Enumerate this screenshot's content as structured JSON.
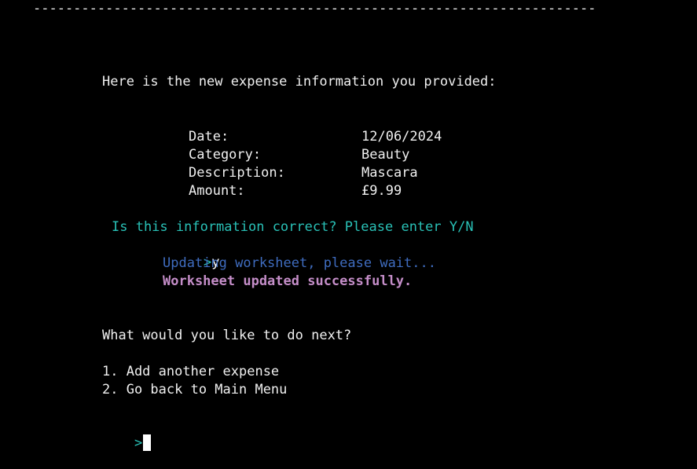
{
  "divider": "----------------------------------------------------------------------",
  "intro": "Here is the new expense information you provided:",
  "expense": {
    "rows": [
      {
        "label": "Date:",
        "value": "12/06/2024"
      },
      {
        "label": "Category:",
        "value": "Beauty"
      },
      {
        "label": "Description:",
        "value": "Mascara"
      },
      {
        "label": "Amount:",
        "value": "£9.99"
      }
    ]
  },
  "confirm_prompt": "Is this information correct? Please enter Y/N",
  "prompt_symbol": ">",
  "user_input": "y",
  "status": {
    "updating": "Updating worksheet, please wait...",
    "success": "Worksheet updated successfully."
  },
  "next_question": "What would you like to do next?",
  "options": [
    "1. Add another expense",
    "2. Go back to Main Menu"
  ],
  "colors": {
    "background": "#000000",
    "text": "#f0f0f0",
    "prompt_cyan": "#29c0b6",
    "status_blue": "#3f6cbf",
    "success_pink": "#c58ec9"
  }
}
